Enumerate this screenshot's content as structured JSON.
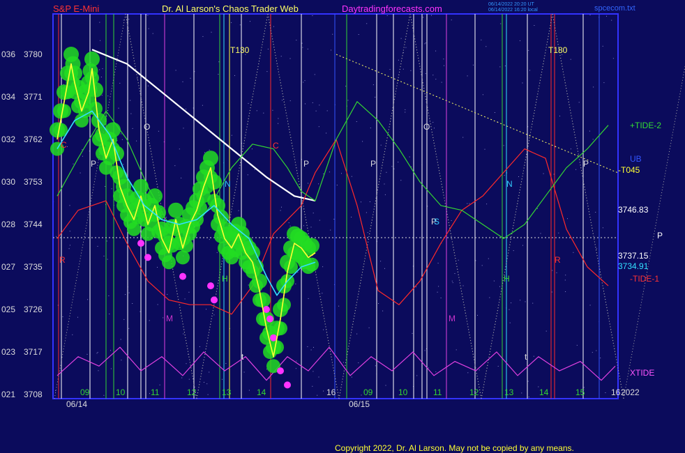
{
  "header": {
    "instrument": "S&P E-Mini",
    "site": "Dr. Al Larson's Chaos Trader Web",
    "url": "Daytradingforecasts.com",
    "stamp_line1": "06/14/2022 20:20 UT",
    "stamp_line2": "06/14/2022 16:20 local",
    "file": "spcecom.txt"
  },
  "footer": {
    "copyright": "Copyright 2022, Dr. Al Larson. May not be copied by any means."
  },
  "colors": {
    "background": "#0b0b5c",
    "plot_border": "#3333ff",
    "price": "#ffff33",
    "ema_fast": "#33e0ff",
    "ema_slow": "#ffffff",
    "tide1": "#ff2a2a",
    "tide2": "#33d633",
    "xtide": "#e040e0",
    "trendline": "#ffff66",
    "green_dots": "#22dd22",
    "magenta_dots": "#ff33ff"
  },
  "chart_data": {
    "type": "line",
    "y_axis": {
      "range": [
        3708,
        3784
      ],
      "ticks": [
        {
          "left": "036",
          "right": "3780"
        },
        {
          "left": "034",
          "right": "3771"
        },
        {
          "left": "032",
          "right": "3762"
        },
        {
          "left": "030",
          "right": "3753"
        },
        {
          "left": "028",
          "right": "3744"
        },
        {
          "left": "027",
          "right": "3735"
        },
        {
          "left": "025",
          "right": "3726"
        },
        {
          "left": "023",
          "right": "3717"
        },
        {
          "left": "021",
          "right": "3708"
        }
      ]
    },
    "x_axis": {
      "hour_labels": [
        "09",
        "10",
        "11",
        "12",
        "13",
        "14",
        "16",
        "09",
        "10",
        "11",
        "12",
        "13",
        "14",
        "15",
        "16"
      ],
      "date_labels": [
        "06/14",
        "06/15"
      ],
      "year_label": "2022"
    },
    "right_labels": {
      "tide2": "+TIDE-2",
      "ub": "UB",
      "t045": "-T045",
      "price_a": "3746.83",
      "p": "P",
      "price_b": "3737.15",
      "price_c": "3734.91",
      "tide1": "-TIDE-1",
      "xtide": "XTIDE"
    },
    "annotations": [
      "T130",
      "T180",
      "C",
      "C",
      "R",
      "R",
      "P",
      "P",
      "P",
      "P",
      "P",
      "O",
      "O",
      "M",
      "M",
      "N",
      "N",
      "S",
      "H",
      "H",
      "t",
      "t"
    ],
    "reference_price": 3745.5,
    "series": [
      {
        "name": "S&P E-Mini",
        "color": "#ffff33",
        "points": [
          [
            0,
            3762
          ],
          [
            2,
            3770
          ],
          [
            4,
            3778
          ],
          [
            5,
            3774
          ],
          [
            7,
            3768
          ],
          [
            9,
            3772
          ],
          [
            10,
            3777
          ],
          [
            12,
            3764
          ],
          [
            14,
            3758
          ],
          [
            16,
            3762
          ],
          [
            18,
            3752
          ],
          [
            20,
            3748
          ],
          [
            22,
            3745
          ],
          [
            24,
            3750
          ],
          [
            26,
            3744
          ],
          [
            28,
            3748
          ],
          [
            30,
            3741
          ],
          [
            32,
            3738
          ],
          [
            34,
            3745
          ],
          [
            36,
            3739
          ],
          [
            38,
            3744
          ],
          [
            40,
            3747
          ],
          [
            42,
            3752
          ],
          [
            44,
            3756
          ],
          [
            46,
            3746
          ],
          [
            48,
            3741
          ],
          [
            50,
            3739
          ],
          [
            52,
            3742
          ],
          [
            54,
            3738
          ],
          [
            56,
            3736
          ],
          [
            58,
            3730
          ],
          [
            60,
            3722
          ],
          [
            62,
            3716
          ],
          [
            64,
            3724
          ],
          [
            66,
            3734
          ],
          [
            68,
            3740
          ],
          [
            70,
            3739
          ],
          [
            72,
            3737
          ],
          [
            74,
            3738
          ]
        ]
      },
      {
        "name": "",
        "color": "#33e0ff",
        "points": [
          [
            0,
            3760
          ],
          [
            5,
            3766
          ],
          [
            10,
            3768
          ],
          [
            15,
            3763
          ],
          [
            20,
            3754
          ],
          [
            25,
            3748
          ],
          [
            30,
            3745
          ],
          [
            35,
            3744
          ],
          [
            40,
            3745
          ],
          [
            45,
            3748
          ],
          [
            50,
            3744
          ],
          [
            55,
            3741
          ],
          [
            60,
            3733
          ],
          [
            63,
            3729
          ],
          [
            66,
            3732
          ],
          [
            70,
            3735
          ],
          [
            74,
            3736
          ]
        ]
      },
      {
        "name": "",
        "color": "#ffffff",
        "points": [
          [
            10,
            3781
          ],
          [
            20,
            3778
          ],
          [
            30,
            3772
          ],
          [
            40,
            3766
          ],
          [
            50,
            3760
          ],
          [
            60,
            3754
          ],
          [
            68,
            3750
          ],
          [
            74,
            3749
          ]
        ]
      },
      {
        "name": "-TIDE-1",
        "color": "#ff2a2a",
        "points": [
          [
            0,
            3741
          ],
          [
            6,
            3747
          ],
          [
            14,
            3749
          ],
          [
            20,
            3740
          ],
          [
            26,
            3732
          ],
          [
            32,
            3728
          ],
          [
            38,
            3727
          ],
          [
            44,
            3727
          ],
          [
            50,
            3725
          ],
          [
            56,
            3731
          ],
          [
            62,
            3742
          ],
          [
            66,
            3745
          ],
          [
            70,
            3748
          ],
          [
            74,
            3755
          ],
          [
            80,
            3762
          ],
          [
            86,
            3748
          ],
          [
            92,
            3730
          ],
          [
            98,
            3727
          ],
          [
            104,
            3732
          ],
          [
            110,
            3740
          ],
          [
            116,
            3747
          ],
          [
            122,
            3750
          ],
          [
            128,
            3755
          ],
          [
            134,
            3760
          ],
          [
            140,
            3758
          ],
          [
            146,
            3743
          ],
          [
            152,
            3735
          ],
          [
            158,
            3731
          ]
        ]
      },
      {
        "name": "+TIDE-2",
        "color": "#33d633",
        "points": [
          [
            0,
            3750
          ],
          [
            6,
            3758
          ],
          [
            14,
            3768
          ],
          [
            20,
            3762
          ],
          [
            26,
            3752
          ],
          [
            32,
            3744
          ],
          [
            38,
            3742
          ],
          [
            44,
            3748
          ],
          [
            50,
            3756
          ],
          [
            56,
            3761
          ],
          [
            62,
            3760
          ],
          [
            66,
            3756
          ],
          [
            70,
            3751
          ],
          [
            74,
            3749
          ],
          [
            80,
            3762
          ],
          [
            86,
            3770
          ],
          [
            92,
            3766
          ],
          [
            98,
            3760
          ],
          [
            104,
            3753
          ],
          [
            110,
            3748
          ],
          [
            116,
            3747
          ],
          [
            122,
            3744
          ],
          [
            128,
            3741
          ],
          [
            134,
            3744
          ],
          [
            140,
            3750
          ],
          [
            146,
            3756
          ],
          [
            152,
            3760
          ],
          [
            158,
            3765
          ]
        ]
      },
      {
        "name": "XTIDE",
        "color": "#e040e0",
        "points": [
          [
            0,
            3712
          ],
          [
            6,
            3716
          ],
          [
            12,
            3714
          ],
          [
            18,
            3718
          ],
          [
            24,
            3713
          ],
          [
            30,
            3716
          ],
          [
            36,
            3712
          ],
          [
            42,
            3717
          ],
          [
            48,
            3713
          ],
          [
            54,
            3716
          ],
          [
            60,
            3711
          ],
          [
            66,
            3716
          ],
          [
            72,
            3713
          ],
          [
            78,
            3718
          ],
          [
            84,
            3712
          ],
          [
            90,
            3716
          ],
          [
            96,
            3713
          ],
          [
            102,
            3717
          ],
          [
            108,
            3712
          ],
          [
            114,
            3715
          ],
          [
            120,
            3713
          ],
          [
            126,
            3717
          ],
          [
            132,
            3712
          ],
          [
            138,
            3716
          ],
          [
            144,
            3713
          ],
          [
            150,
            3715
          ],
          [
            156,
            3711
          ],
          [
            160,
            3714
          ]
        ]
      }
    ]
  }
}
